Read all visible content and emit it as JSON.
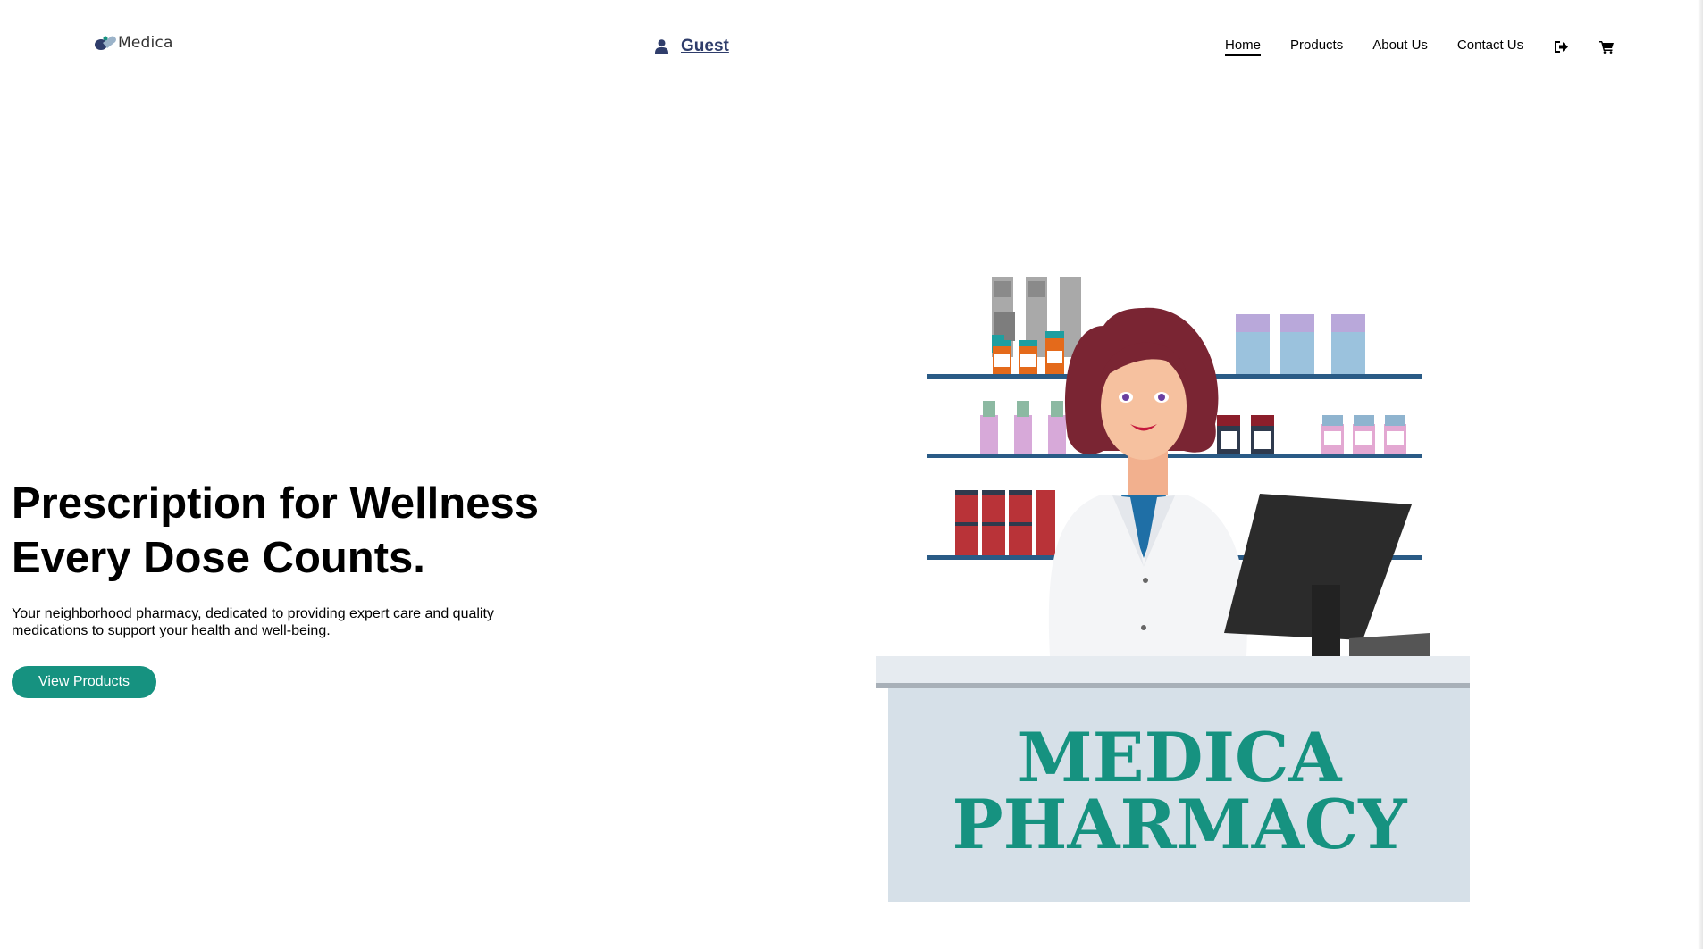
{
  "brand": {
    "name": "Medica"
  },
  "user": {
    "label": "Guest"
  },
  "nav": {
    "items": [
      {
        "label": "Home",
        "active": true
      },
      {
        "label": "Products",
        "active": false
      },
      {
        "label": "About Us",
        "active": false
      },
      {
        "label": "Contact Us",
        "active": false
      }
    ],
    "icons": [
      "sign-out-icon",
      "cart-icon"
    ]
  },
  "hero": {
    "title_line1": "Prescription for Wellness",
    "title_line2": "Every Dose Counts.",
    "subtitle": "Your neighborhood pharmacy, dedicated to providing expert care and quality medications to support your health and well-being.",
    "cta_label": "View Products"
  },
  "illustration": {
    "counter_line1": "MEDICA",
    "counter_line2": "PHARMACY"
  },
  "colors": {
    "accent": "#169280",
    "user_text": "#2f3d6b",
    "shelf": "#2a5b86",
    "counter": "#d6e0e8"
  }
}
